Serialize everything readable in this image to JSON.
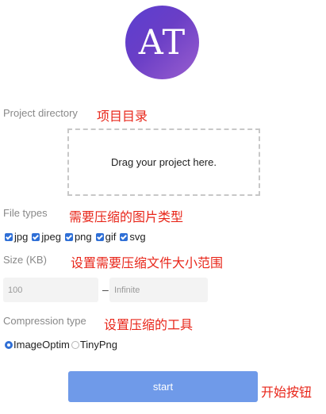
{
  "logo": {
    "text": "AT"
  },
  "project": {
    "label": "Project directory",
    "note": "项目目录",
    "drop_text": "Drag your project here."
  },
  "file_types": {
    "label": "File types",
    "note": "需要压缩的图片类型",
    "options": [
      {
        "label": "jpg",
        "checked": true
      },
      {
        "label": "jpeg",
        "checked": true
      },
      {
        "label": "png",
        "checked": true
      },
      {
        "label": "gif",
        "checked": true
      },
      {
        "label": "svg",
        "checked": true
      }
    ]
  },
  "size": {
    "label": "Size (KB)",
    "note": "设置需要压缩文件大小范围",
    "min_value": "100",
    "separator": "–",
    "max_placeholder": "Infinite"
  },
  "compression": {
    "label": "Compression type",
    "note": "设置压缩的工具",
    "options": [
      {
        "label": "ImageOptim",
        "selected": true
      },
      {
        "label": "TinyPng",
        "selected": false
      }
    ]
  },
  "start": {
    "label": "start",
    "note": "开始按钮"
  },
  "colors": {
    "accent": "#2f6fd6",
    "button": "#6f9ae9",
    "note": "#e8261a"
  }
}
